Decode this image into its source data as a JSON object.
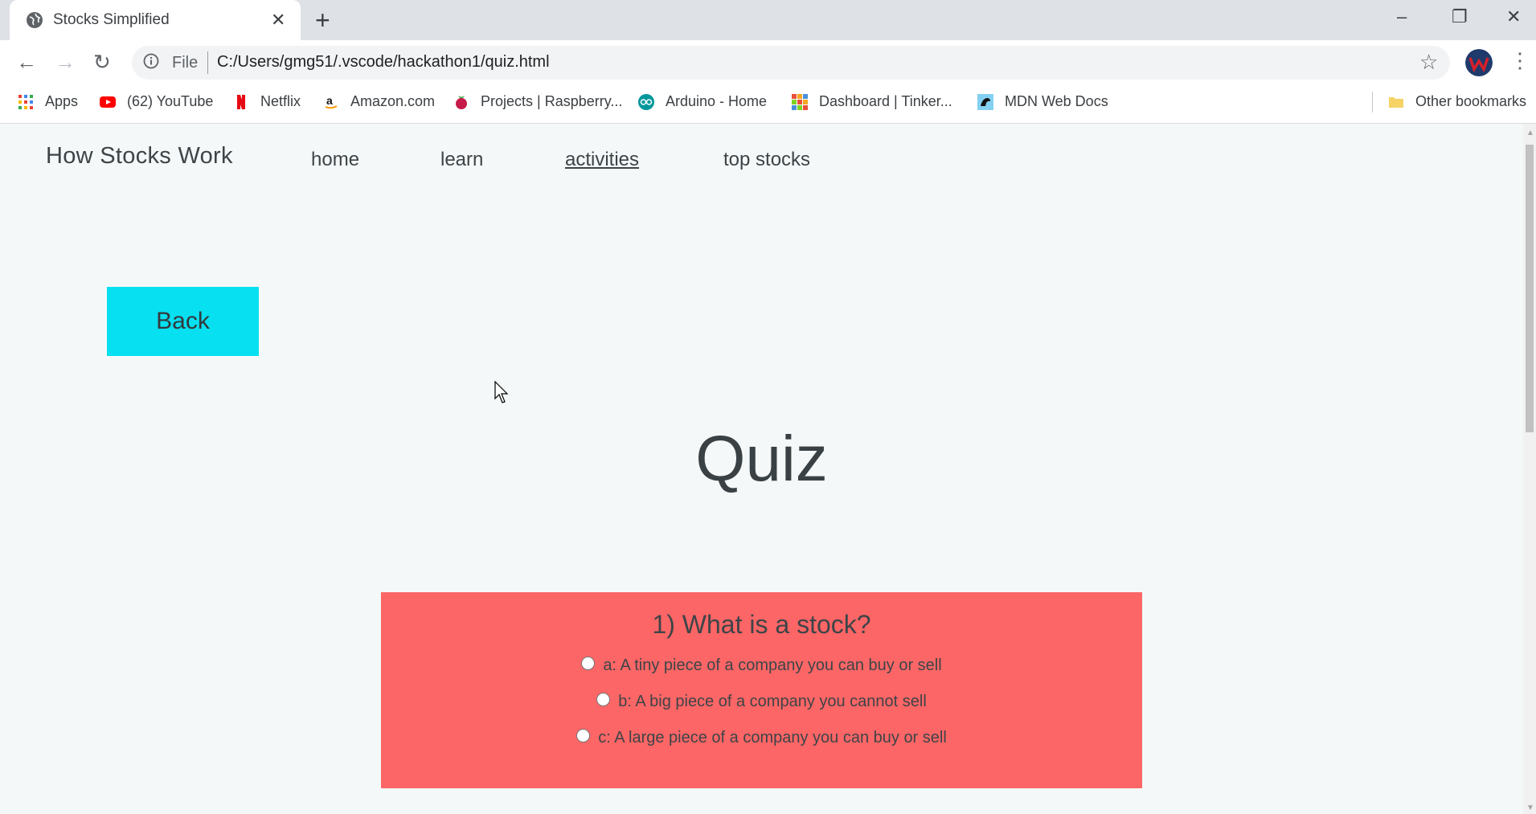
{
  "browser": {
    "tab_title": "Stocks Simplified",
    "tab_close": "✕",
    "new_tab": "+",
    "window_controls": {
      "minimize": "–",
      "restore": "❐",
      "close": "✕"
    },
    "nav": {
      "back": "←",
      "forward": "→",
      "reload": "↻"
    },
    "address": {
      "scheme_label": "File",
      "url": "C:/Users/gmg51/.vscode/hackathon1/quiz.html"
    },
    "star": "☆",
    "menu": "⋮",
    "bookmarks": [
      {
        "label": "Apps",
        "icon": "apps-grid-icon",
        "color": "#4285f4"
      },
      {
        "label": "(62) YouTube",
        "icon": "youtube-icon",
        "color": "#ff0000"
      },
      {
        "label": "Netflix",
        "icon": "netflix-icon",
        "color": "#e50914"
      },
      {
        "label": "Amazon.com",
        "icon": "amazon-icon",
        "color": "#000000"
      },
      {
        "label": "Projects | Raspberry...",
        "icon": "raspberry-icon",
        "color": "#c51a4a"
      },
      {
        "label": "Arduino - Home",
        "icon": "arduino-icon",
        "color": "#00979c"
      },
      {
        "label": "Dashboard | Tinker...",
        "icon": "tinkercad-icon",
        "color": "#e8a33a"
      },
      {
        "label": "MDN Web Docs",
        "icon": "mdn-icon",
        "color": "#83d0f2"
      }
    ],
    "other_bookmarks": "Other bookmarks"
  },
  "site": {
    "brand": "How Stocks Work",
    "nav": [
      {
        "label": "home",
        "active": false
      },
      {
        "label": "learn",
        "active": false
      },
      {
        "label": "activities",
        "active": true
      },
      {
        "label": "top stocks",
        "active": false
      }
    ],
    "back_button": "Back",
    "title": "Quiz",
    "question": {
      "text": "1) What is a stock?",
      "options": [
        "a: A tiny piece of a company you can buy or sell",
        "b: A big piece of a company you cannot sell",
        "c: A large piece of a company you can buy or sell"
      ]
    }
  },
  "colors": {
    "page_bg": "#f4f8f8",
    "back_button": "#07e0f0",
    "question_card": "#fd6666",
    "text": "#3d4448"
  }
}
